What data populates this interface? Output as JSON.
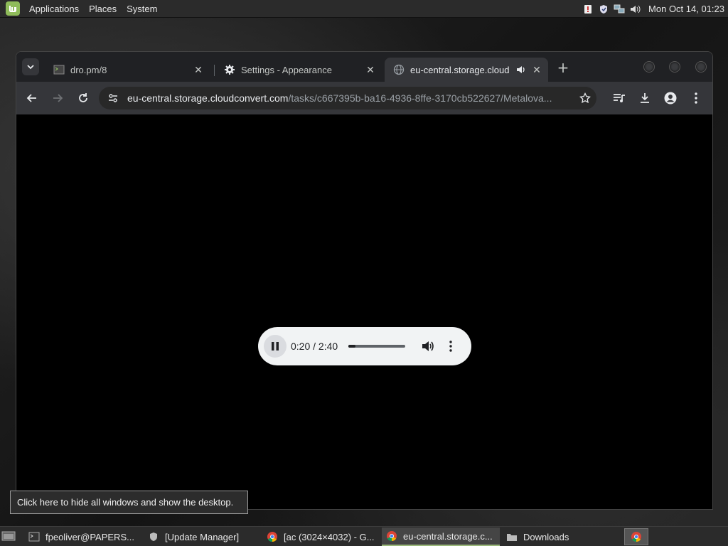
{
  "top_panel": {
    "menus": [
      "Applications",
      "Places",
      "System"
    ],
    "clock": "Mon Oct 14, 01:23",
    "tray_icons": [
      "update-icon",
      "shield-icon",
      "network-icon",
      "volume-icon"
    ]
  },
  "browser": {
    "tabs": [
      {
        "label": "dro.pm/8",
        "favicon": "terminal-icon"
      },
      {
        "label": "Settings - Appearance",
        "favicon": "gear-icon"
      },
      {
        "label": "eu-central.storage.cloud",
        "favicon": "globe-icon",
        "active": true,
        "audio": true
      }
    ],
    "url_host": "eu-central.storage.cloudconvert.com",
    "url_path": "/tasks/c667395b-ba16-4936-8ffe-3170cb522627/Metalova..."
  },
  "player": {
    "time": "0:20 / 2:40",
    "progress": 0.125
  },
  "tooltip": "Click here to hide all windows and show the desktop.",
  "taskbar": {
    "items": [
      {
        "label": "fpeoliver@PAPERS...",
        "icon": "terminal-icon"
      },
      {
        "label": "[Update Manager]",
        "icon": "shield-icon"
      },
      {
        "label": "[ac (3024×4032) - G...",
        "icon": "chrome-icon"
      },
      {
        "label": "eu-central.storage.c...",
        "icon": "chrome-icon",
        "active": true
      },
      {
        "label": "Downloads",
        "icon": "folder-icon"
      }
    ]
  },
  "colors": {
    "panel": "#2b2b2b",
    "tab_active": "#35363a",
    "tabbar": "#202124",
    "mint_green": "#8fbc5a"
  }
}
